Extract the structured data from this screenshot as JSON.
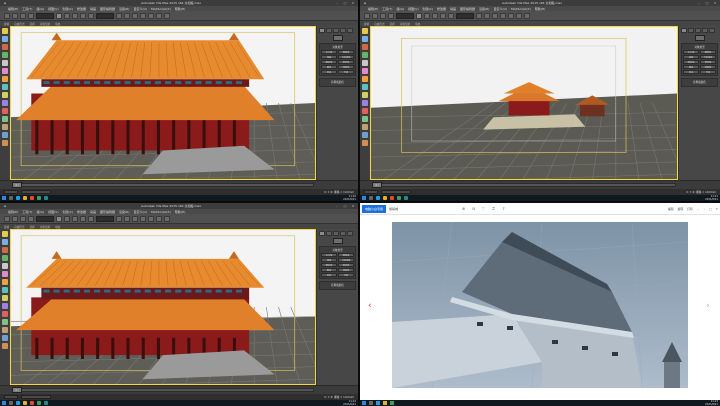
{
  "max_panes": [
    {
      "title": "Autodesk 3ds Max 2015 x64   太和殿.max",
      "viewport_label": "[+][透视][真实]",
      "menus": [
        "编辑(E)",
        "工具(T)",
        "组(G)",
        "视图(V)",
        "创建(C)",
        "修改器",
        "动画",
        "图形编辑器",
        "渲染(R)",
        "自定义(U)",
        "MAXScript(X)",
        "帮助(H)"
      ],
      "ribbon": [
        "建模",
        "自由形式",
        "选择",
        "对象绘制",
        "填充"
      ],
      "panel_title": "对象类型",
      "panel_buttons": [
        "长方体",
        "圆锥体",
        "球体",
        "几何球体",
        "圆柱体",
        "管状体",
        "圆环",
        "四棱锥",
        "茶壶",
        "平面"
      ],
      "panel_section": "名称和颜色",
      "frame": "0 / 100",
      "coords": "X:  Y:  Z:  栅格 = 10.0mm",
      "clock_time": "11:20",
      "clock_date": "2021/6/21"
    },
    {
      "title": "Autodesk 3ds Max 2015 x64   太和殿.max",
      "viewport_label": "[+][透视][真实]",
      "menus": [
        "编辑(E)",
        "工具(T)",
        "组(G)",
        "视图(V)",
        "创建(C)",
        "修改器",
        "动画",
        "图形编辑器",
        "渲染(R)",
        "自定义(U)",
        "MAXScript(X)",
        "帮助(H)"
      ],
      "ribbon": [
        "建模",
        "自由形式",
        "选择",
        "对象绘制",
        "填充"
      ],
      "panel_title": "对象类型",
      "panel_buttons": [
        "长方体",
        "圆锥体",
        "球体",
        "几何球体",
        "圆柱体",
        "管状体",
        "圆环",
        "四棱锥",
        "茶壶",
        "平面"
      ],
      "panel_section": "名称和颜色",
      "frame": "0 / 100",
      "coords": "X:  Y:  Z:  栅格 = 10.0mm",
      "clock_time": "11:21",
      "clock_date": "2021/6/21"
    },
    {
      "title": "Autodesk 3ds Max 2015 x64   太和殿.max",
      "viewport_label": "[+][透视][真实]",
      "menus": [
        "编辑(E)",
        "工具(T)",
        "组(G)",
        "视图(V)",
        "创建(C)",
        "修改器",
        "动画",
        "图形编辑器",
        "渲染(R)",
        "自定义(U)",
        "MAXScript(X)",
        "帮助(H)"
      ],
      "ribbon": [
        "建模",
        "自由形式",
        "选择",
        "对象绘制",
        "填充"
      ],
      "panel_title": "对象类型",
      "panel_buttons": [
        "长方体",
        "圆锥体",
        "球体",
        "几何球体",
        "圆柱体",
        "管状体",
        "圆环",
        "四棱锥",
        "茶壶",
        "平面"
      ],
      "panel_section": "名称和颜色",
      "frame": "0 / 100",
      "coords": "X:  Y:  Z:  栅格 = 10.0mm",
      "clock_time": "11:22",
      "clock_date": "2021/6/21"
    }
  ],
  "viewer": {
    "brand": "电脑小白专用",
    "file_name": "紫禁城",
    "right_actions": [
      "编辑",
      "旋转",
      "打印"
    ],
    "clock_time": "11:23",
    "clock_date": "2021/6/21"
  },
  "colors": {
    "roof": "#e0802a",
    "wall": "#8b1a1a",
    "viewport_grid": "#6b6b6b",
    "accent": "#1e6fd9"
  }
}
